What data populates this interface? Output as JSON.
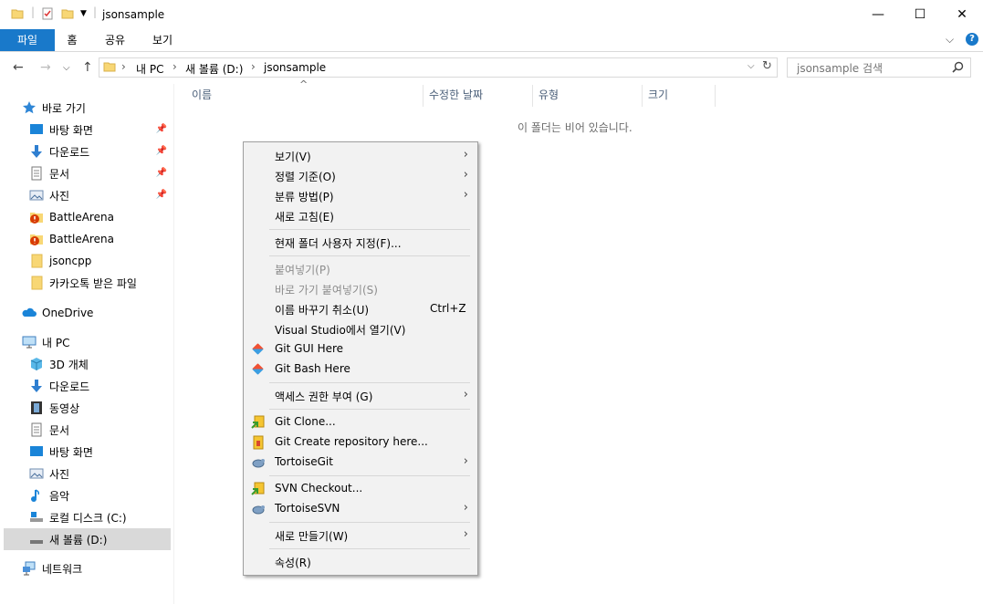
{
  "window": {
    "title": "jsonsample",
    "minimize": "—",
    "maximize": "☐",
    "close": "✕"
  },
  "ribbon": {
    "tabs": [
      "파일",
      "홈",
      "공유",
      "보기"
    ],
    "expand": "⌵",
    "help": "?"
  },
  "address": {
    "back": "←",
    "forward": "→",
    "recent": "⌵",
    "up": "↑",
    "crumbs": [
      "내 PC",
      "새 볼륨 (D:)",
      "jsonsample"
    ],
    "sep": "›",
    "dropdown": "⌵",
    "refresh": "↻",
    "search_placeholder": "jsonsample 검색",
    "search_icon": "search-icon"
  },
  "nav": {
    "quick_access": "바로 가기",
    "quick_items": [
      "바탕 화면",
      "다운로드",
      "문서",
      "사진",
      "BattleArena",
      "BattleArena",
      "jsoncpp",
      "카카오톡 받은 파일"
    ],
    "onedrive": "OneDrive",
    "this_pc": "내 PC",
    "pc_items": [
      "3D 개체",
      "다운로드",
      "동영상",
      "문서",
      "바탕 화면",
      "사진",
      "음악",
      "로컬 디스크 (C:)",
      "새 볼륨 (D:)"
    ],
    "network": "네트워크"
  },
  "content": {
    "sort_arrow": "^",
    "columns": [
      "이름",
      "수정한 날짜",
      "유형",
      "크기"
    ],
    "empty_message": "이 폴더는 비어 있습니다."
  },
  "context_menu": {
    "items": [
      {
        "label": "보기(V)",
        "submenu": true
      },
      {
        "label": "정렬 기준(O)",
        "submenu": true
      },
      {
        "label": "분류 방법(P)",
        "submenu": true
      },
      {
        "label": "새로 고침(E)"
      },
      {
        "label": "현재 폴더 사용자 지정(F)..."
      },
      {
        "label": "붙여넣기(P)",
        "disabled": true
      },
      {
        "label": "바로 가기 붙여넣기(S)",
        "disabled": true
      },
      {
        "label": "이름 바꾸기 취소(U)",
        "shortcut": "Ctrl+Z"
      },
      {
        "label": "Visual Studio에서 열기(V)"
      },
      {
        "label": "Git GUI Here",
        "icon": "git-icon"
      },
      {
        "label": "Git Bash Here",
        "icon": "git-icon"
      },
      {
        "label": "액세스 권한 부여 (G)",
        "submenu": true
      },
      {
        "label": "Git Clone...",
        "icon": "git-clone-icon"
      },
      {
        "label": "Git Create repository here...",
        "icon": "git-create-repo-icon"
      },
      {
        "label": "TortoiseGit",
        "icon": "tortoise-icon",
        "submenu": true
      },
      {
        "label": "SVN Checkout...",
        "icon": "svn-checkout-icon"
      },
      {
        "label": "TortoiseSVN",
        "icon": "tortoise-icon",
        "submenu": true
      },
      {
        "label": "새로 만들기(W)",
        "submenu": true
      },
      {
        "label": "속성(R)"
      }
    ],
    "arrow": "›"
  },
  "colors": {
    "accent": "#1979ca",
    "folder": "#f8d775",
    "selection": "#d9d9d9"
  }
}
